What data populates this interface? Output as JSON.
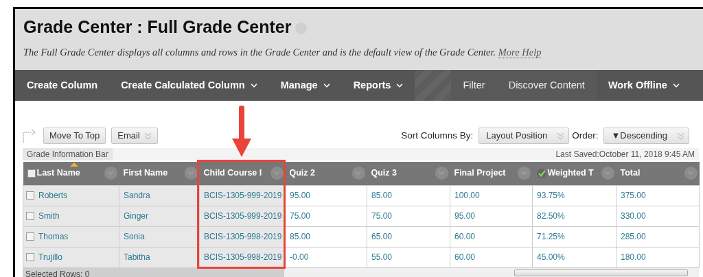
{
  "page": {
    "title": "Grade Center : Full Grade Center",
    "description": "The Full Grade Center displays all columns and rows in the Grade Center and is the default view of the Grade Center.",
    "help_link": "More Help"
  },
  "toolbar": [
    {
      "kind": "bold",
      "label": "Create Column",
      "dropdown": false
    },
    {
      "kind": "bold",
      "label": "Create Calculated Column",
      "dropdown": true
    },
    {
      "kind": "bold",
      "label": "Manage",
      "dropdown": true
    },
    {
      "kind": "bold",
      "label": "Reports",
      "dropdown": true
    },
    {
      "kind": "spacer"
    },
    {
      "kind": "plain",
      "label": "Filter",
      "dropdown": false
    },
    {
      "kind": "plain",
      "label": "Discover Content",
      "dropdown": false
    },
    {
      "kind": "bold",
      "label": "Work Offline",
      "dropdown": true
    }
  ],
  "actions": [
    {
      "label": "Move To Top",
      "dropdown": false
    },
    {
      "label": "Email",
      "dropdown": true
    }
  ],
  "sort": {
    "label": "Sort Columns By:",
    "value": "Layout Position",
    "order_label": "Order:",
    "order_value": "▼Descending"
  },
  "info_bar": {
    "tab": "Grade Information Bar",
    "last_saved": "Last Saved:October 11, 2018 9:45 AM"
  },
  "table": {
    "all_selected": false,
    "columns": [
      {
        "label": "Last Name",
        "kind": "select",
        "frozen": true,
        "sorted": true,
        "highlighted": false
      },
      {
        "label": "First Name",
        "kind": "text",
        "frozen": true,
        "sorted": false,
        "highlighted": false
      },
      {
        "label": "Child Course I",
        "kind": "text",
        "frozen": true,
        "sorted": false,
        "highlighted": true
      },
      {
        "label": "Quiz 2",
        "kind": "text",
        "frozen": false,
        "sorted": false,
        "highlighted": false
      },
      {
        "label": "Quiz 3",
        "kind": "text",
        "frozen": false,
        "sorted": false,
        "highlighted": false
      },
      {
        "label": "Final Project",
        "kind": "text",
        "frozen": false,
        "sorted": false,
        "highlighted": false
      },
      {
        "label": "Weighted T",
        "kind": "weighted",
        "frozen": false,
        "sorted": false,
        "highlighted": false
      },
      {
        "label": "Total",
        "kind": "text",
        "frozen": false,
        "sorted": false,
        "highlighted": false
      }
    ],
    "rows": [
      {
        "checked": false,
        "cells": [
          "Roberts",
          "Sandra",
          "BCIS-1305-999-2019",
          "95.00",
          "85.00",
          "100.00",
          "93.75%",
          "375.00"
        ]
      },
      {
        "checked": false,
        "cells": [
          "Smith",
          "Ginger",
          "BCIS-1305-999-2019",
          "75.00",
          "75.00",
          "95.00",
          "82.50%",
          "330.00"
        ]
      },
      {
        "checked": false,
        "cells": [
          "Thomas",
          "Sonia",
          "BCIS-1305-998-2019",
          "85.00",
          "65.00",
          "60.00",
          "71.25%",
          "285.00"
        ]
      },
      {
        "checked": false,
        "cells": [
          "Trujillo",
          "Tabitha",
          "BCIS-1305-998-2019",
          "-0.00",
          "55.00",
          "60.00",
          "45.00%",
          "180.00"
        ]
      }
    ],
    "selected_rows": "Selected Rows: 0"
  }
}
